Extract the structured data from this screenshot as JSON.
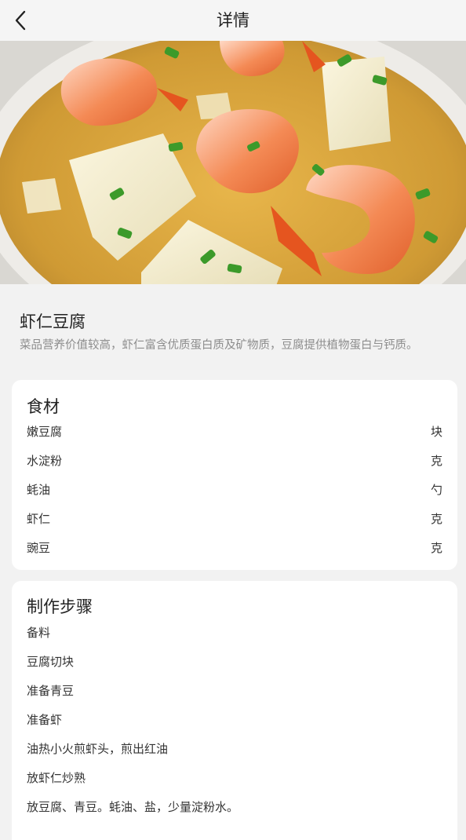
{
  "header": {
    "title": "详情"
  },
  "dish": {
    "name": "虾仁豆腐",
    "description": "菜品营养价值较高，虾仁富含优质蛋白质及矿物质，豆腐提供植物蛋白与钙质。",
    "image_icon": "dish-photo"
  },
  "ingredients": {
    "title": "食材",
    "items": [
      {
        "name": "嫩豆腐",
        "unit": "块"
      },
      {
        "name": "水淀粉",
        "unit": "克"
      },
      {
        "name": "蚝油",
        "unit": "勺"
      },
      {
        "name": "虾仁",
        "unit": "克"
      },
      {
        "name": "豌豆",
        "unit": "克"
      }
    ]
  },
  "steps": {
    "title": "制作步骤",
    "items": [
      "备料",
      "豆腐切块",
      "准备青豆",
      "准备虾",
      "油热小火煎虾头，煎出红油",
      "放虾仁炒熟",
      "放豆腐、青豆。蚝油、盐，少量淀粉水。"
    ]
  },
  "colors": {
    "background": "#f2f2f2",
    "card": "#ffffff",
    "secondary_text": "#8d8d8d",
    "shrimp": "#f07a45",
    "broth": "#d9a83c"
  }
}
